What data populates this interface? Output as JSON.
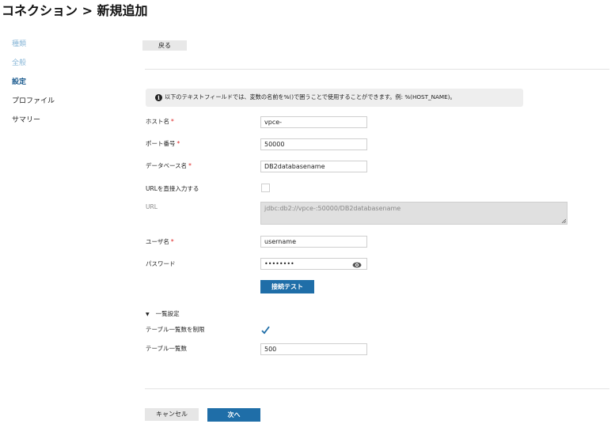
{
  "header": {
    "title": "コネクション > 新規追加"
  },
  "sidebar": {
    "items": [
      {
        "label": "種類",
        "state": "done"
      },
      {
        "label": "全般",
        "state": "done"
      },
      {
        "label": "設定",
        "state": "current"
      },
      {
        "label": "プロファイル",
        "state": "todo"
      },
      {
        "label": "サマリー",
        "state": "todo"
      }
    ]
  },
  "toolbar": {
    "back_label": "戻る"
  },
  "info": {
    "icon": "info-icon",
    "text": "以下のテキストフィールドでは、変数の名前を%()で囲うことで使用することができます。例: %(HOST_NAME)。"
  },
  "form": {
    "hostname": {
      "label": "ホスト名",
      "required": "*",
      "value": "vpce-"
    },
    "port": {
      "label": "ポート番号",
      "required": "*",
      "value": "50000"
    },
    "database": {
      "label": "データベース名",
      "required": "*",
      "value": "DB2databasename"
    },
    "direct_url": {
      "label": "URLを直接入力する",
      "checked": false
    },
    "url": {
      "label": "URL",
      "value": "jdbc:db2://vpce-:50000/DB2databasename"
    },
    "username": {
      "label": "ユーザ名",
      "required": "*",
      "value": "username"
    },
    "password": {
      "label": "パスワード",
      "value": "••••••••",
      "icon": "eye-icon"
    },
    "test_button": "接続テスト"
  },
  "list_settings": {
    "toggle_label": "一覧設定",
    "limit": {
      "label": "テーブル一覧数を制限",
      "checked": true
    },
    "count": {
      "label": "テーブル一覧数",
      "value": "500"
    }
  },
  "footer": {
    "cancel_label": "キャンセル",
    "next_label": "次へ"
  },
  "colors": {
    "primary": "#1f6ea8",
    "required": "#dd2222",
    "done_step": "#8bb8d8",
    "current_step": "#1a5a8e"
  }
}
